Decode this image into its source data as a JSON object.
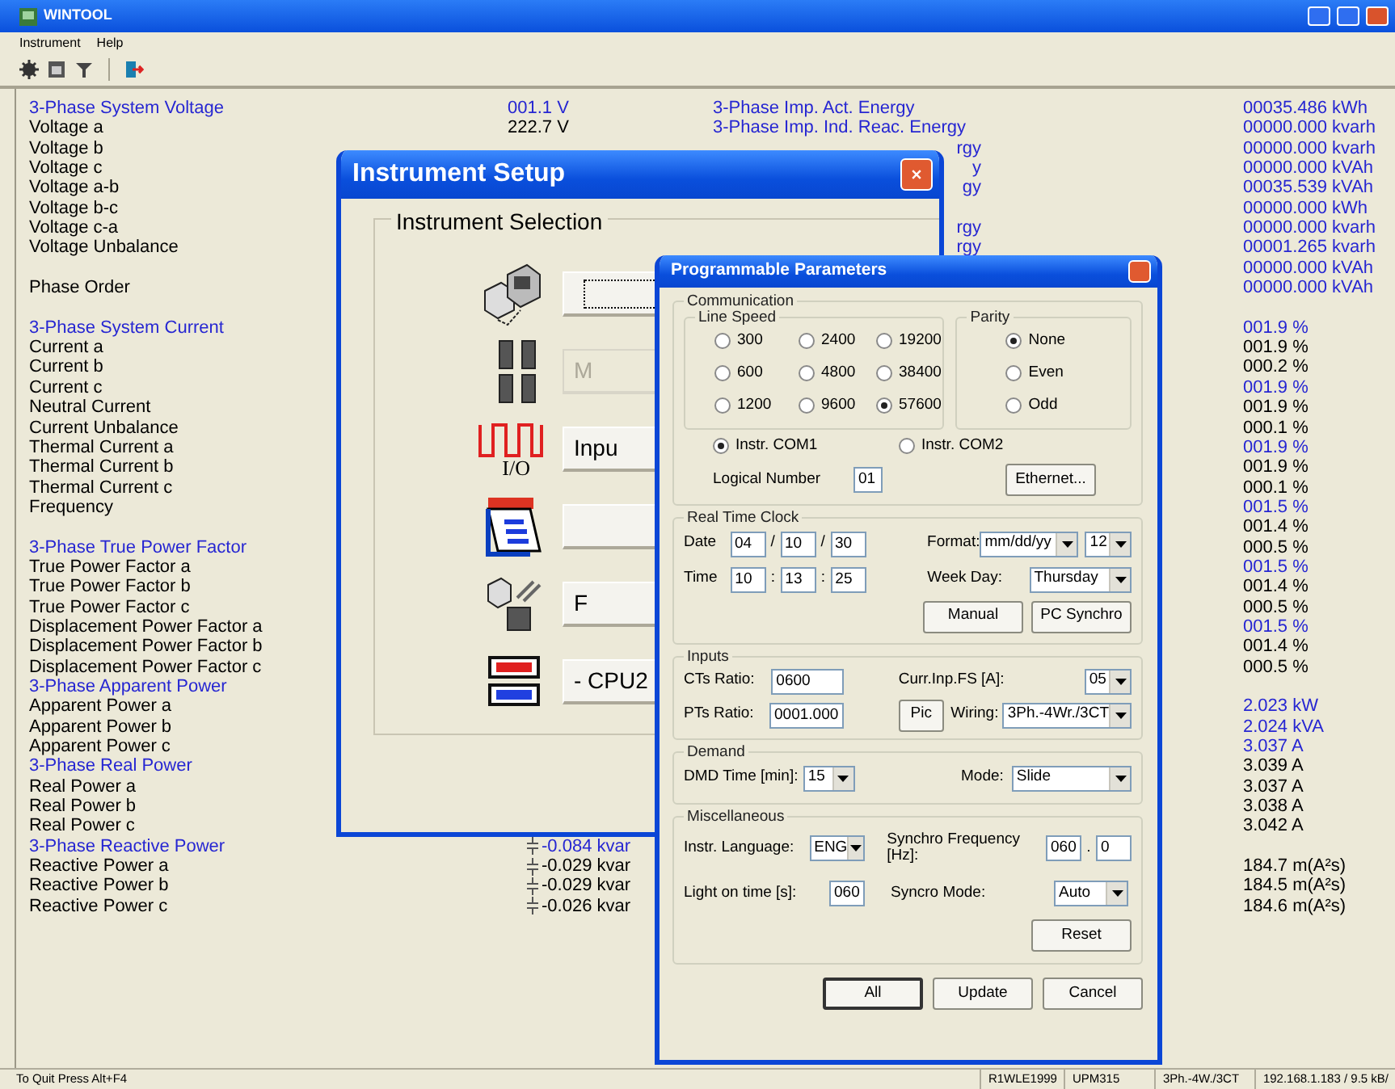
{
  "window": {
    "title": "WINTOOL"
  },
  "menu": [
    "Instrument",
    "Help"
  ],
  "readings": [
    {
      "label": {
        "text": "3-Phase System Voltage",
        "heading": true
      },
      "value": {
        "text": "001.1 V",
        "highlight": true
      },
      "energy": {
        "text": "3-Phase Imp. Act. Energy",
        "kind": "full"
      },
      "total": {
        "text": "00035.486 kWh",
        "highlight": true
      }
    },
    {
      "label": {
        "text": "Voltage a",
        "heading": false
      },
      "value": {
        "text": "222.7 V",
        "highlight": false
      },
      "energy": {
        "text": "3-Phase Imp. Ind. Reac. Energy",
        "kind": "full"
      },
      "total": {
        "text": "00000.000 kvarh",
        "highlight": true
      }
    },
    {
      "label": {
        "text": "Voltage b",
        "heading": false
      },
      "energy": {
        "text": "rgy",
        "kind": "fragment"
      },
      "total": {
        "text": "00000.000 kvarh",
        "highlight": true
      }
    },
    {
      "label": {
        "text": "Voltage c",
        "heading": false
      },
      "energy": {
        "text": "y",
        "kind": "fragment"
      },
      "total": {
        "text": "00000.000 kVAh",
        "highlight": true
      }
    },
    {
      "label": {
        "text": "Voltage a-b",
        "heading": false
      },
      "energy": {
        "text": "gy",
        "kind": "fragment"
      },
      "total": {
        "text": "00035.539 kVAh",
        "highlight": true
      }
    },
    {
      "label": {
        "text": "Voltage b-c",
        "heading": false
      },
      "total": {
        "text": "00000.000 kWh",
        "highlight": true
      }
    },
    {
      "label": {
        "text": "Voltage c-a",
        "heading": false
      },
      "energy": {
        "text": "rgy",
        "kind": "fragment"
      },
      "total": {
        "text": "00000.000 kvarh",
        "highlight": true
      }
    },
    {
      "label": {
        "text": "Voltage Unbalance",
        "heading": false
      },
      "energy": {
        "text": "rgy",
        "kind": "fragment"
      },
      "total": {
        "text": "00001.265 kvarh",
        "highlight": true
      }
    },
    {
      "total": {
        "text": "00000.000 kVAh",
        "highlight": true
      }
    },
    {
      "label": {
        "text": "Phase Order",
        "heading": false
      },
      "total": {
        "text": "00000.000 kVAh",
        "highlight": true
      }
    }
  ],
  "readings_lower": [
    {
      "label": {
        "text": "3-Phase System Current",
        "heading": true
      },
      "total": {
        "text": "001.9 %",
        "highlight": true
      }
    },
    {
      "label": {
        "text": "Current a",
        "heading": false
      },
      "total": {
        "text": "001.9 %",
        "highlight": false
      }
    },
    {
      "label": {
        "text": "Current b",
        "heading": false
      },
      "total": {
        "text": "000.2 %",
        "highlight": false
      }
    },
    {
      "label": {
        "text": "Current c",
        "heading": false
      },
      "total": {
        "text": "001.9 %",
        "highlight": true
      }
    },
    {
      "label": {
        "text": "Neutral Current",
        "heading": false
      },
      "total": {
        "text": "001.9 %",
        "highlight": false
      }
    },
    {
      "label": {
        "text": "Current Unbalance",
        "heading": false
      },
      "total": {
        "text": "000.1 %",
        "highlight": false
      }
    },
    {
      "label": {
        "text": "Thermal Current a",
        "heading": false
      },
      "total": {
        "text": "001.9 %",
        "highlight": true
      }
    },
    {
      "label": {
        "text": "Thermal Current b",
        "heading": false
      },
      "total": {
        "text": "001.9 %",
        "highlight": false
      }
    },
    {
      "label": {
        "text": "Thermal Current c",
        "heading": false
      },
      "total": {
        "text": "000.1 %",
        "highlight": false
      }
    },
    {
      "label": {
        "text": "Frequency",
        "heading": false
      },
      "total": {
        "text": "001.5 %",
        "highlight": true
      }
    },
    {
      "total": {
        "text": "001.4 %",
        "highlight": false
      }
    },
    {
      "label": {
        "text": "3-Phase True Power Factor",
        "heading": true
      },
      "total": {
        "text": "000.5 %",
        "highlight": false
      }
    },
    {
      "label": {
        "text": "True Power Factor a",
        "heading": false
      },
      "total": {
        "text": "001.5 %",
        "highlight": true
      }
    },
    {
      "label": {
        "text": "True Power Factor b",
        "heading": false
      },
      "total": {
        "text": "001.4 %",
        "highlight": false
      }
    },
    {
      "label": {
        "text": "True Power Factor c",
        "heading": false
      },
      "total": {
        "text": "000.5 %",
        "highlight": false
      }
    },
    {
      "label": {
        "text": "Displacement Power Factor a",
        "heading": false
      },
      "total": {
        "text": "001.5 %",
        "highlight": true
      }
    },
    {
      "label": {
        "text": "Displacement Power Factor b",
        "heading": false
      },
      "total": {
        "text": "001.4 %",
        "highlight": false
      }
    },
    {
      "label": {
        "text": "Displacement Power Factor c",
        "heading": false
      },
      "total": {
        "text": "000.5 %",
        "highlight": false
      }
    },
    {
      "label": {
        "text": "3-Phase Apparent Power",
        "heading": true
      }
    },
    {
      "label": {
        "text": "Apparent Power a",
        "heading": false
      },
      "total": {
        "text": "2.023 kW",
        "highlight": true
      }
    },
    {
      "label": {
        "text": "Apparent Power b",
        "heading": false
      },
      "total": {
        "text": "2.024 kVA",
        "highlight": true
      }
    },
    {
      "label": {
        "text": "Apparent Power c",
        "heading": false
      },
      "total": {
        "text": "3.037 A",
        "highlight": true
      }
    },
    {
      "label": {
        "text": "3-Phase Real Power",
        "heading": true
      },
      "total": {
        "text": "3.039 A",
        "highlight": false
      }
    },
    {
      "label": {
        "text": "Real Power a",
        "heading": false
      },
      "total": {
        "text": "3.037 A",
        "highlight": false
      }
    },
    {
      "label": {
        "text": "Real Power b",
        "heading": false
      },
      "total": {
        "text": "3.038 A",
        "highlight": false
      }
    },
    {
      "label": {
        "text": "Real Power c",
        "heading": false
      },
      "total": {
        "text": "3.042 A",
        "highlight": false
      }
    },
    {
      "label": {
        "text": "3-Phase Reactive Power",
        "heading": true
      },
      "value": {
        "text": "-0.084 kvar",
        "highlight": true,
        "kind": "reactive"
      }
    },
    {
      "label": {
        "text": "Reactive Power a",
        "heading": false
      },
      "value": {
        "text": "-0.029 kvar",
        "highlight": false,
        "kind": "reactive"
      },
      "total": {
        "text": "184.7 m(A²s)",
        "highlight": false
      }
    },
    {
      "label": {
        "text": "Reactive Power b",
        "heading": false
      },
      "value": {
        "text": "-0.029 kvar",
        "highlight": false,
        "kind": "reactive"
      },
      "total": {
        "text": "184.5 m(A²s)",
        "highlight": false
      }
    },
    {
      "label": {
        "text": "Reactive Power c",
        "heading": false
      },
      "value": {
        "text": "-0.026 kvar",
        "highlight": false,
        "kind": "reactive"
      },
      "total": {
        "text": "184.6 m(A²s)",
        "highlight": false
      }
    }
  ],
  "instrument_setup": {
    "title": "Instrument Setup",
    "group": "Instrument Selection",
    "items": [
      {
        "kind": "link",
        "focused": true,
        "disabled": false
      },
      {
        "kind": "memory",
        "label": "M",
        "focused": false,
        "disabled": true
      },
      {
        "kind": "io",
        "caption": "I/O",
        "label": "Inpu",
        "focused": false,
        "disabled": false
      },
      {
        "kind": "calendar",
        "focused": false,
        "disabled": false
      },
      {
        "kind": "reset",
        "label": "F",
        "focused": false,
        "disabled": false
      },
      {
        "kind": "cpu",
        "label": "- CPU2",
        "focused": false,
        "disabled": false
      }
    ]
  },
  "parameters": {
    "title": "Programmable Parameters",
    "communication": {
      "title": "Communication",
      "line_speed": {
        "title": "Line Speed",
        "options": [
          {
            "label": "300",
            "selected": false
          },
          {
            "label": "2400",
            "selected": false
          },
          {
            "label": "19200",
            "selected": false
          },
          {
            "label": "600",
            "selected": false
          },
          {
            "label": "4800",
            "selected": false
          },
          {
            "label": "38400",
            "selected": false
          },
          {
            "label": "1200",
            "selected": false
          },
          {
            "label": "9600",
            "selected": false
          },
          {
            "label": "57600",
            "selected": true
          }
        ]
      },
      "parity": {
        "title": "Parity",
        "options": [
          {
            "label": "None",
            "selected": true
          },
          {
            "label": "Even",
            "selected": false
          },
          {
            "label": "Odd",
            "selected": false
          }
        ]
      },
      "ports": [
        {
          "label": "Instr. COM1",
          "selected": true
        },
        {
          "label": "Instr. COM2",
          "selected": false
        }
      ],
      "logical_number": {
        "label": "Logical Number",
        "value": "01"
      },
      "ethernet_button": "Ethernet..."
    },
    "clock": {
      "title": "Real Time Clock",
      "date": {
        "label": "Date",
        "parts": [
          {
            "kind": "field",
            "text": "04"
          },
          {
            "kind": "sep",
            "text": "/"
          },
          {
            "kind": "field",
            "text": "10"
          },
          {
            "kind": "sep",
            "text": "/"
          },
          {
            "kind": "field",
            "text": "30"
          }
        ]
      },
      "format": {
        "label": "Format:",
        "value": "mm/dd/yy",
        "hours": "12"
      },
      "time": {
        "label": "Time",
        "parts": [
          {
            "kind": "field",
            "text": "10"
          },
          {
            "kind": "sep",
            "text": ":"
          },
          {
            "kind": "field",
            "text": "13"
          },
          {
            "kind": "sep",
            "text": ":"
          },
          {
            "kind": "field",
            "text": "25"
          }
        ]
      },
      "week_day": {
        "label": "Week Day:",
        "value": "Thursday"
      },
      "buttons": [
        "Manual",
        "PC Synchro"
      ]
    },
    "inputs": {
      "title": "Inputs",
      "ct_ratio": {
        "label": "CTs Ratio:",
        "value": "0600"
      },
      "full_scale": {
        "label": "Curr.Inp.FS [A]:",
        "value": "05"
      },
      "pt_ratio": {
        "label": "PTs Ratio:",
        "value": "0001.000"
      },
      "pic_button": "Pic",
      "wiring": {
        "label": "Wiring:",
        "value": "3Ph.-4Wr./3CT"
      }
    },
    "demand": {
      "title": "Demand",
      "time": {
        "label": "DMD Time [min]:",
        "value": "15"
      },
      "mode": {
        "label": "Mode:",
        "value": "Slide"
      }
    },
    "misc": {
      "title": "Miscellaneous",
      "language": {
        "label": "Instr. Language:",
        "value": "ENG"
      },
      "synchro": {
        "label": "Synchro Frequency [Hz]:",
        "parts": [
          {
            "kind": "field",
            "text": "060"
          },
          {
            "kind": "sep",
            "text": "."
          },
          {
            "kind": "field",
            "text": "0"
          }
        ]
      },
      "light": {
        "label": "Light on time [s]:",
        "value": "060"
      },
      "syncro_mode": {
        "label": "Syncro Mode:",
        "value": "Auto"
      },
      "reset_button": "Reset"
    },
    "footer": [
      {
        "label": "All",
        "default": true
      },
      {
        "label": "Update",
        "default": false
      },
      {
        "label": "Cancel",
        "default": false
      }
    ]
  },
  "status_bar": {
    "hint": "To Quit Press Alt+F4",
    "panes": [
      "R1WLE1999",
      "UPM315",
      "3Ph.-4W./3CT",
      "192.168.1.183 / 9.5 kB/"
    ]
  }
}
